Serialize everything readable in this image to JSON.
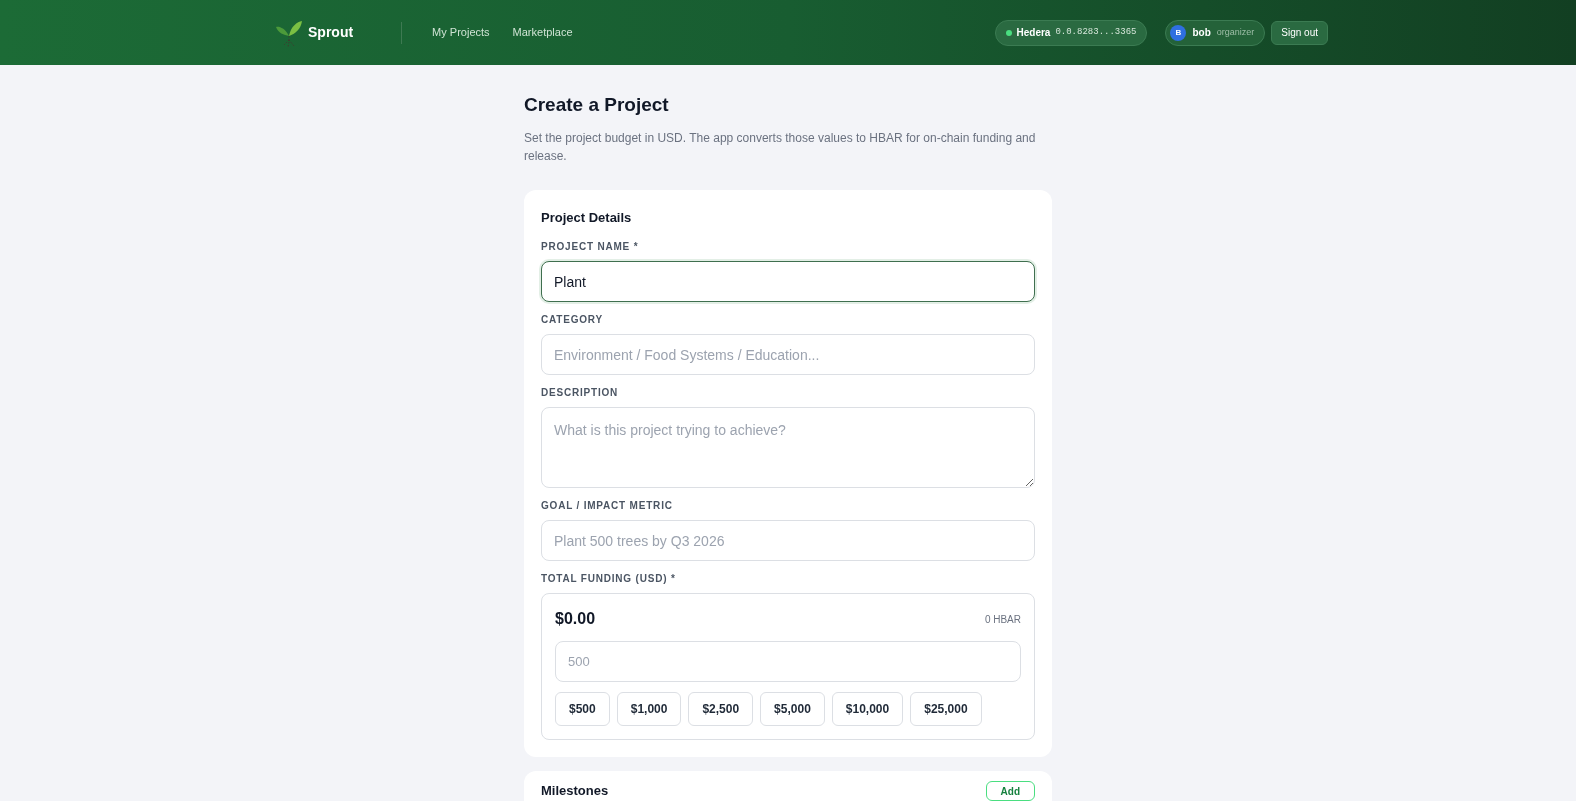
{
  "header": {
    "brand": "Sprout",
    "nav": [
      {
        "label": "My Projects",
        "selected": false
      },
      {
        "label": "Marketplace",
        "selected": false
      }
    ],
    "wallet": {
      "network": "Hedera",
      "account": "0.0.8283...3365",
      "connected": true
    },
    "user": {
      "initial": "B",
      "name": "bob",
      "role": "organizer"
    },
    "sign_out": "Sign out"
  },
  "page": {
    "title": "Create a Project",
    "subtitle": "Set the project budget in USD. The app converts those values to HBAR for on-chain funding and release."
  },
  "details": {
    "title": "Project Details",
    "fields": [
      {
        "kind": "input",
        "label": "PROJECT NAME *",
        "value": "Plant",
        "focused": true
      },
      {
        "kind": "input",
        "label": "CATEGORY",
        "placeholder": "Environment / Food Systems / Education...",
        "focused": false
      },
      {
        "kind": "textarea",
        "label": "DESCRIPTION",
        "placeholder": "What is this project trying to achieve?",
        "focused": false
      },
      {
        "kind": "input",
        "label": "GOAL / IMPACT METRIC",
        "placeholder": "Plant 500 trees by Q3 2026",
        "focused": false
      }
    ],
    "funding": {
      "label": "TOTAL FUNDING (USD) *",
      "amount": "$0.00",
      "hbar": "0 HBAR",
      "placeholder": "500",
      "presets": [
        "$500",
        "$1,000",
        "$2,500",
        "$5,000",
        "$10,000",
        "$25,000"
      ]
    }
  },
  "milestones": {
    "title": "Milestones",
    "add": "Add"
  }
}
